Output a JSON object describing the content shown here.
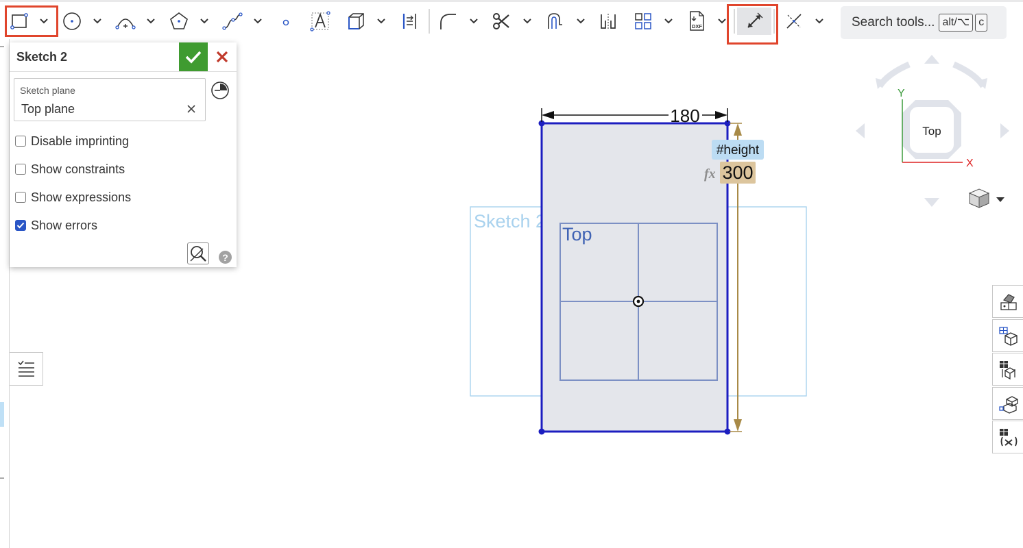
{
  "search": {
    "label": "Search tools...",
    "key1": "alt/⌥",
    "key2": "c"
  },
  "panel": {
    "title": "Sketch 2",
    "plane_label": "Sketch plane",
    "plane_value": "Top plane",
    "options": [
      {
        "label": "Disable imprinting",
        "checked": false
      },
      {
        "label": "Show constraints",
        "checked": false
      },
      {
        "label": "Show expressions",
        "checked": false
      },
      {
        "label": "Show errors",
        "checked": true
      }
    ],
    "help": "?"
  },
  "canvas": {
    "sketch_label": "Sketch 2",
    "plane_label": "Top",
    "width_dimension": "180",
    "height_variable": "#height",
    "fx_symbol": "fx",
    "height_dimension": "300"
  },
  "view_cube": {
    "face": "Top",
    "axis_y": "Y",
    "axis_x": "X"
  },
  "colors": {
    "highlight": "#e0452c",
    "sketch_blue": "#1c1ec0",
    "dimension_gold": "#a88a47",
    "accept_green": "#3f9b30",
    "cancel_red": "#c0392b"
  }
}
